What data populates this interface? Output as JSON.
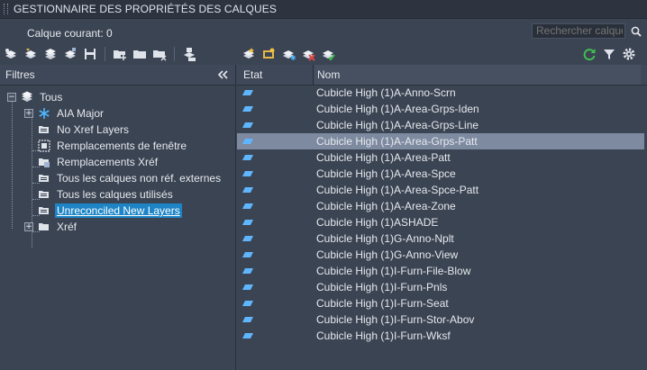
{
  "window": {
    "title": "GESTIONNAIRE DES PROPRIÉTÉS DES CALQUES"
  },
  "current_layer": "Calque courant: 0",
  "search": {
    "placeholder": "Rechercher calque"
  },
  "colors": {
    "accent": "#1d84c6",
    "selected_row": "#7d8aa0",
    "refresh_icon": "#3fbf4f"
  },
  "toolbar_left_icons": [
    "new-property-filter-icon",
    "new-group-filter-icon",
    "layer-states-manager-icon",
    "layer-settings-icon",
    "save-icon",
    "new-layer-icon",
    "new-layer-vp-frozen-icon",
    "delete-layer-icon",
    "set-current-icon",
    "layer-translator-icon"
  ],
  "filters_panel": {
    "header": "Filtres",
    "tree": [
      {
        "label": "Tous",
        "icon": "layers-stack-icon",
        "expander": "−"
      },
      {
        "label": "AIA Major",
        "icon": "snowflake-filter-icon",
        "expander": "+"
      },
      {
        "label": "No Xref Layers",
        "icon": "group-filter-icon"
      },
      {
        "label": "Remplacements de fenêtre",
        "icon": "viewport-override-icon"
      },
      {
        "label": "Remplacements Xréf",
        "icon": "xref-override-icon"
      },
      {
        "label": "Tous les calques non réf. externes",
        "icon": "group-filter-icon"
      },
      {
        "label": "Tous les calques utilisés",
        "icon": "group-filter-icon"
      },
      {
        "label": "Unreconciled New Layers",
        "icon": "unreconciled-filter-icon",
        "selected": true
      },
      {
        "label": "Xréf",
        "icon": "xref-filter-icon",
        "expander": "+"
      }
    ]
  },
  "grid": {
    "columns": {
      "etat": "Etat",
      "nom": "Nom"
    },
    "rows": [
      {
        "name": "Cubicle High (1)A-Anno-Scrn"
      },
      {
        "name": "Cubicle High (1)A-Area-Grps-Iden"
      },
      {
        "name": "Cubicle High (1)A-Area-Grps-Line"
      },
      {
        "name": "Cubicle High (1)A-Area-Grps-Patt",
        "selected": true
      },
      {
        "name": "Cubicle High (1)A-Area-Patt"
      },
      {
        "name": "Cubicle High (1)A-Area-Spce"
      },
      {
        "name": "Cubicle High (1)A-Area-Spce-Patt"
      },
      {
        "name": "Cubicle High (1)A-Area-Zone"
      },
      {
        "name": "Cubicle High (1)ASHADE"
      },
      {
        "name": "Cubicle High (1)G-Anno-Nplt"
      },
      {
        "name": "Cubicle High (1)G-Anno-View"
      },
      {
        "name": "Cubicle High (1)I-Furn-File-Blow"
      },
      {
        "name": "Cubicle High (1)I-Furn-Pnls"
      },
      {
        "name": "Cubicle High (1)I-Furn-Seat"
      },
      {
        "name": "Cubicle High (1)I-Furn-Stor-Abov"
      },
      {
        "name": "Cubicle High (1)I-Furn-Wksf"
      }
    ]
  }
}
